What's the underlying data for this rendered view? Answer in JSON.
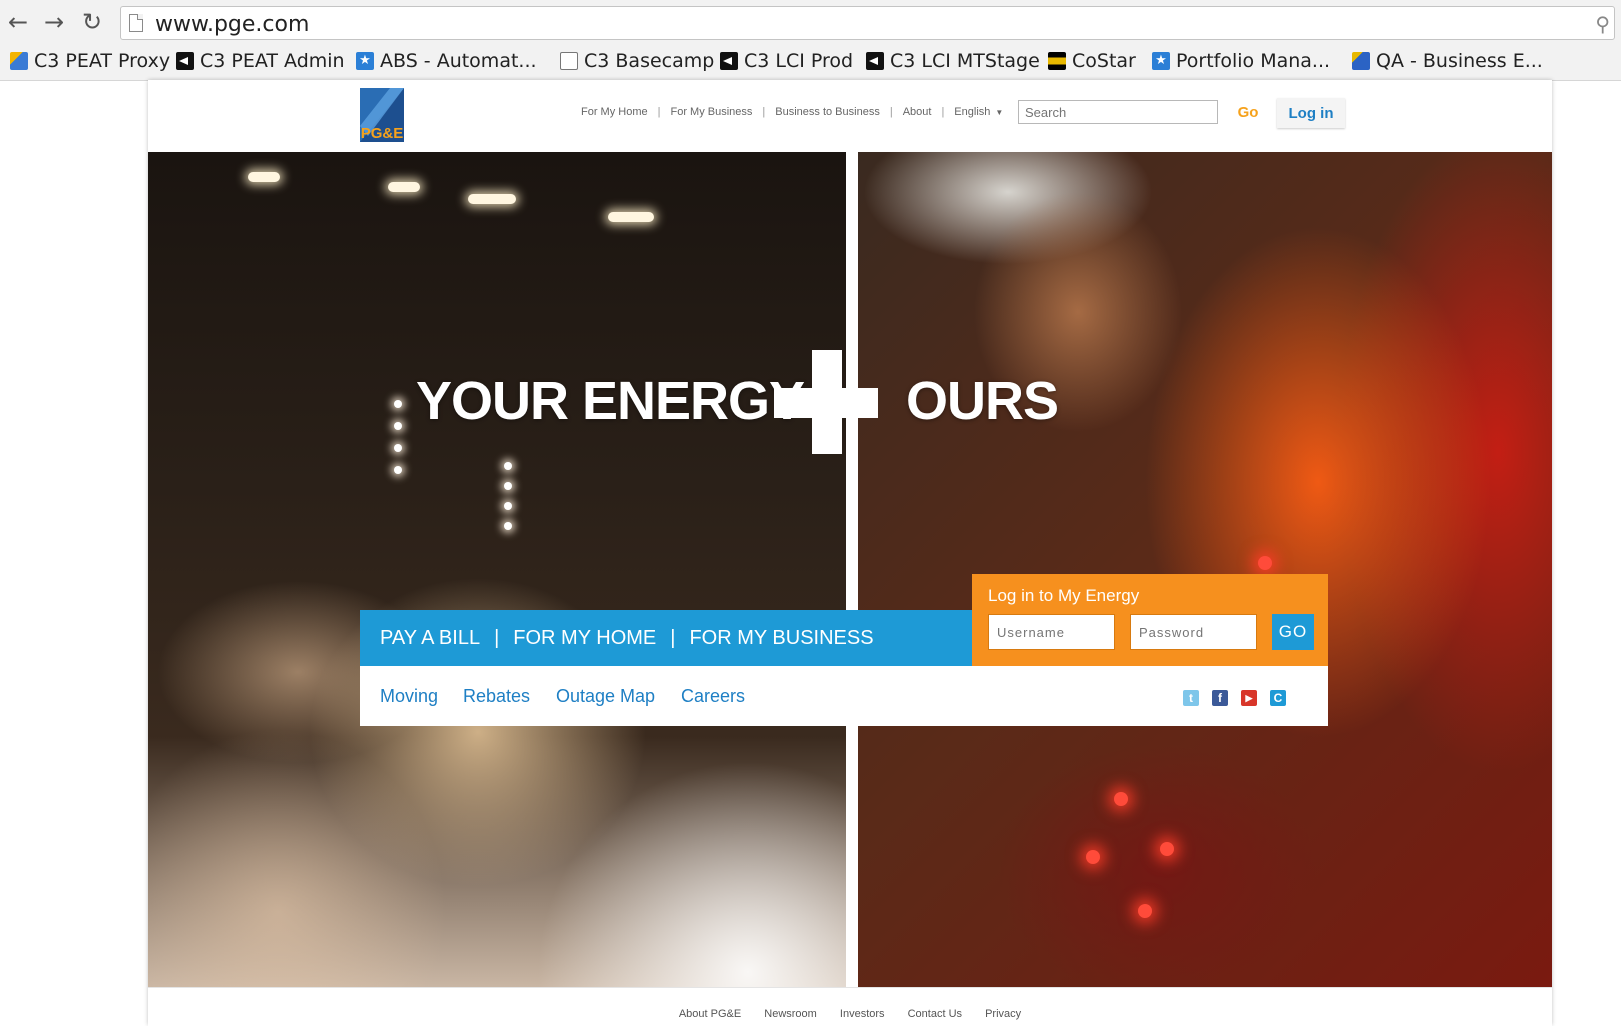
{
  "browser": {
    "url": "www.pge.com",
    "bookmarks": [
      {
        "label": "C3 PEAT Proxy",
        "icon": "chart-favicon-icon"
      },
      {
        "label": "C3 PEAT Admin",
        "icon": "c3-favicon-icon"
      },
      {
        "label": "ABS - Automat...",
        "icon": "star-favicon-icon"
      },
      {
        "label": "C3 Basecamp",
        "icon": "page-icon"
      },
      {
        "label": "C3 LCI Prod",
        "icon": "c3-favicon-icon"
      },
      {
        "label": "C3 LCI MTStage",
        "icon": "c3-favicon-icon"
      },
      {
        "label": "CoStar",
        "icon": "costar-favicon-icon"
      },
      {
        "label": "Portfolio Mana...",
        "icon": "star-favicon-icon"
      },
      {
        "label": "QA - Business E...",
        "icon": "chart-favicon-icon"
      }
    ]
  },
  "site": {
    "logo_text": "PG&E",
    "topnav": [
      "For My Home",
      "For My Business",
      "Business to Business",
      "About",
      "English"
    ],
    "search_placeholder": "Search",
    "search_go": "Go",
    "login_button": "Log in"
  },
  "hero": {
    "headline_left": "YOUR ENERGY",
    "headline_right": "OURS"
  },
  "actions": {
    "pay_bill": "PAY A BILL",
    "separator": "|",
    "for_home": "FOR MY HOME",
    "for_business": "FOR MY BUSINESS"
  },
  "login": {
    "title": "Log in to My Energy",
    "username_placeholder": "Username",
    "password_placeholder": "Password",
    "go": "GO"
  },
  "quicklinks": [
    "Moving",
    "Rebates",
    "Outage Map",
    "Careers"
  ],
  "social": [
    {
      "icon": "twitter-icon",
      "glyph": "t",
      "color": "#7ec6ea"
    },
    {
      "icon": "facebook-icon",
      "glyph": "f",
      "color": "#3b5998"
    },
    {
      "icon": "youtube-icon",
      "glyph": "▶",
      "color": "#d8362a"
    },
    {
      "icon": "currents-icon",
      "glyph": "C",
      "color": "#1e9ad6"
    }
  ],
  "footer": [
    "About PG&E",
    "Newsroom",
    "Investors",
    "Contact Us",
    "Privacy"
  ]
}
